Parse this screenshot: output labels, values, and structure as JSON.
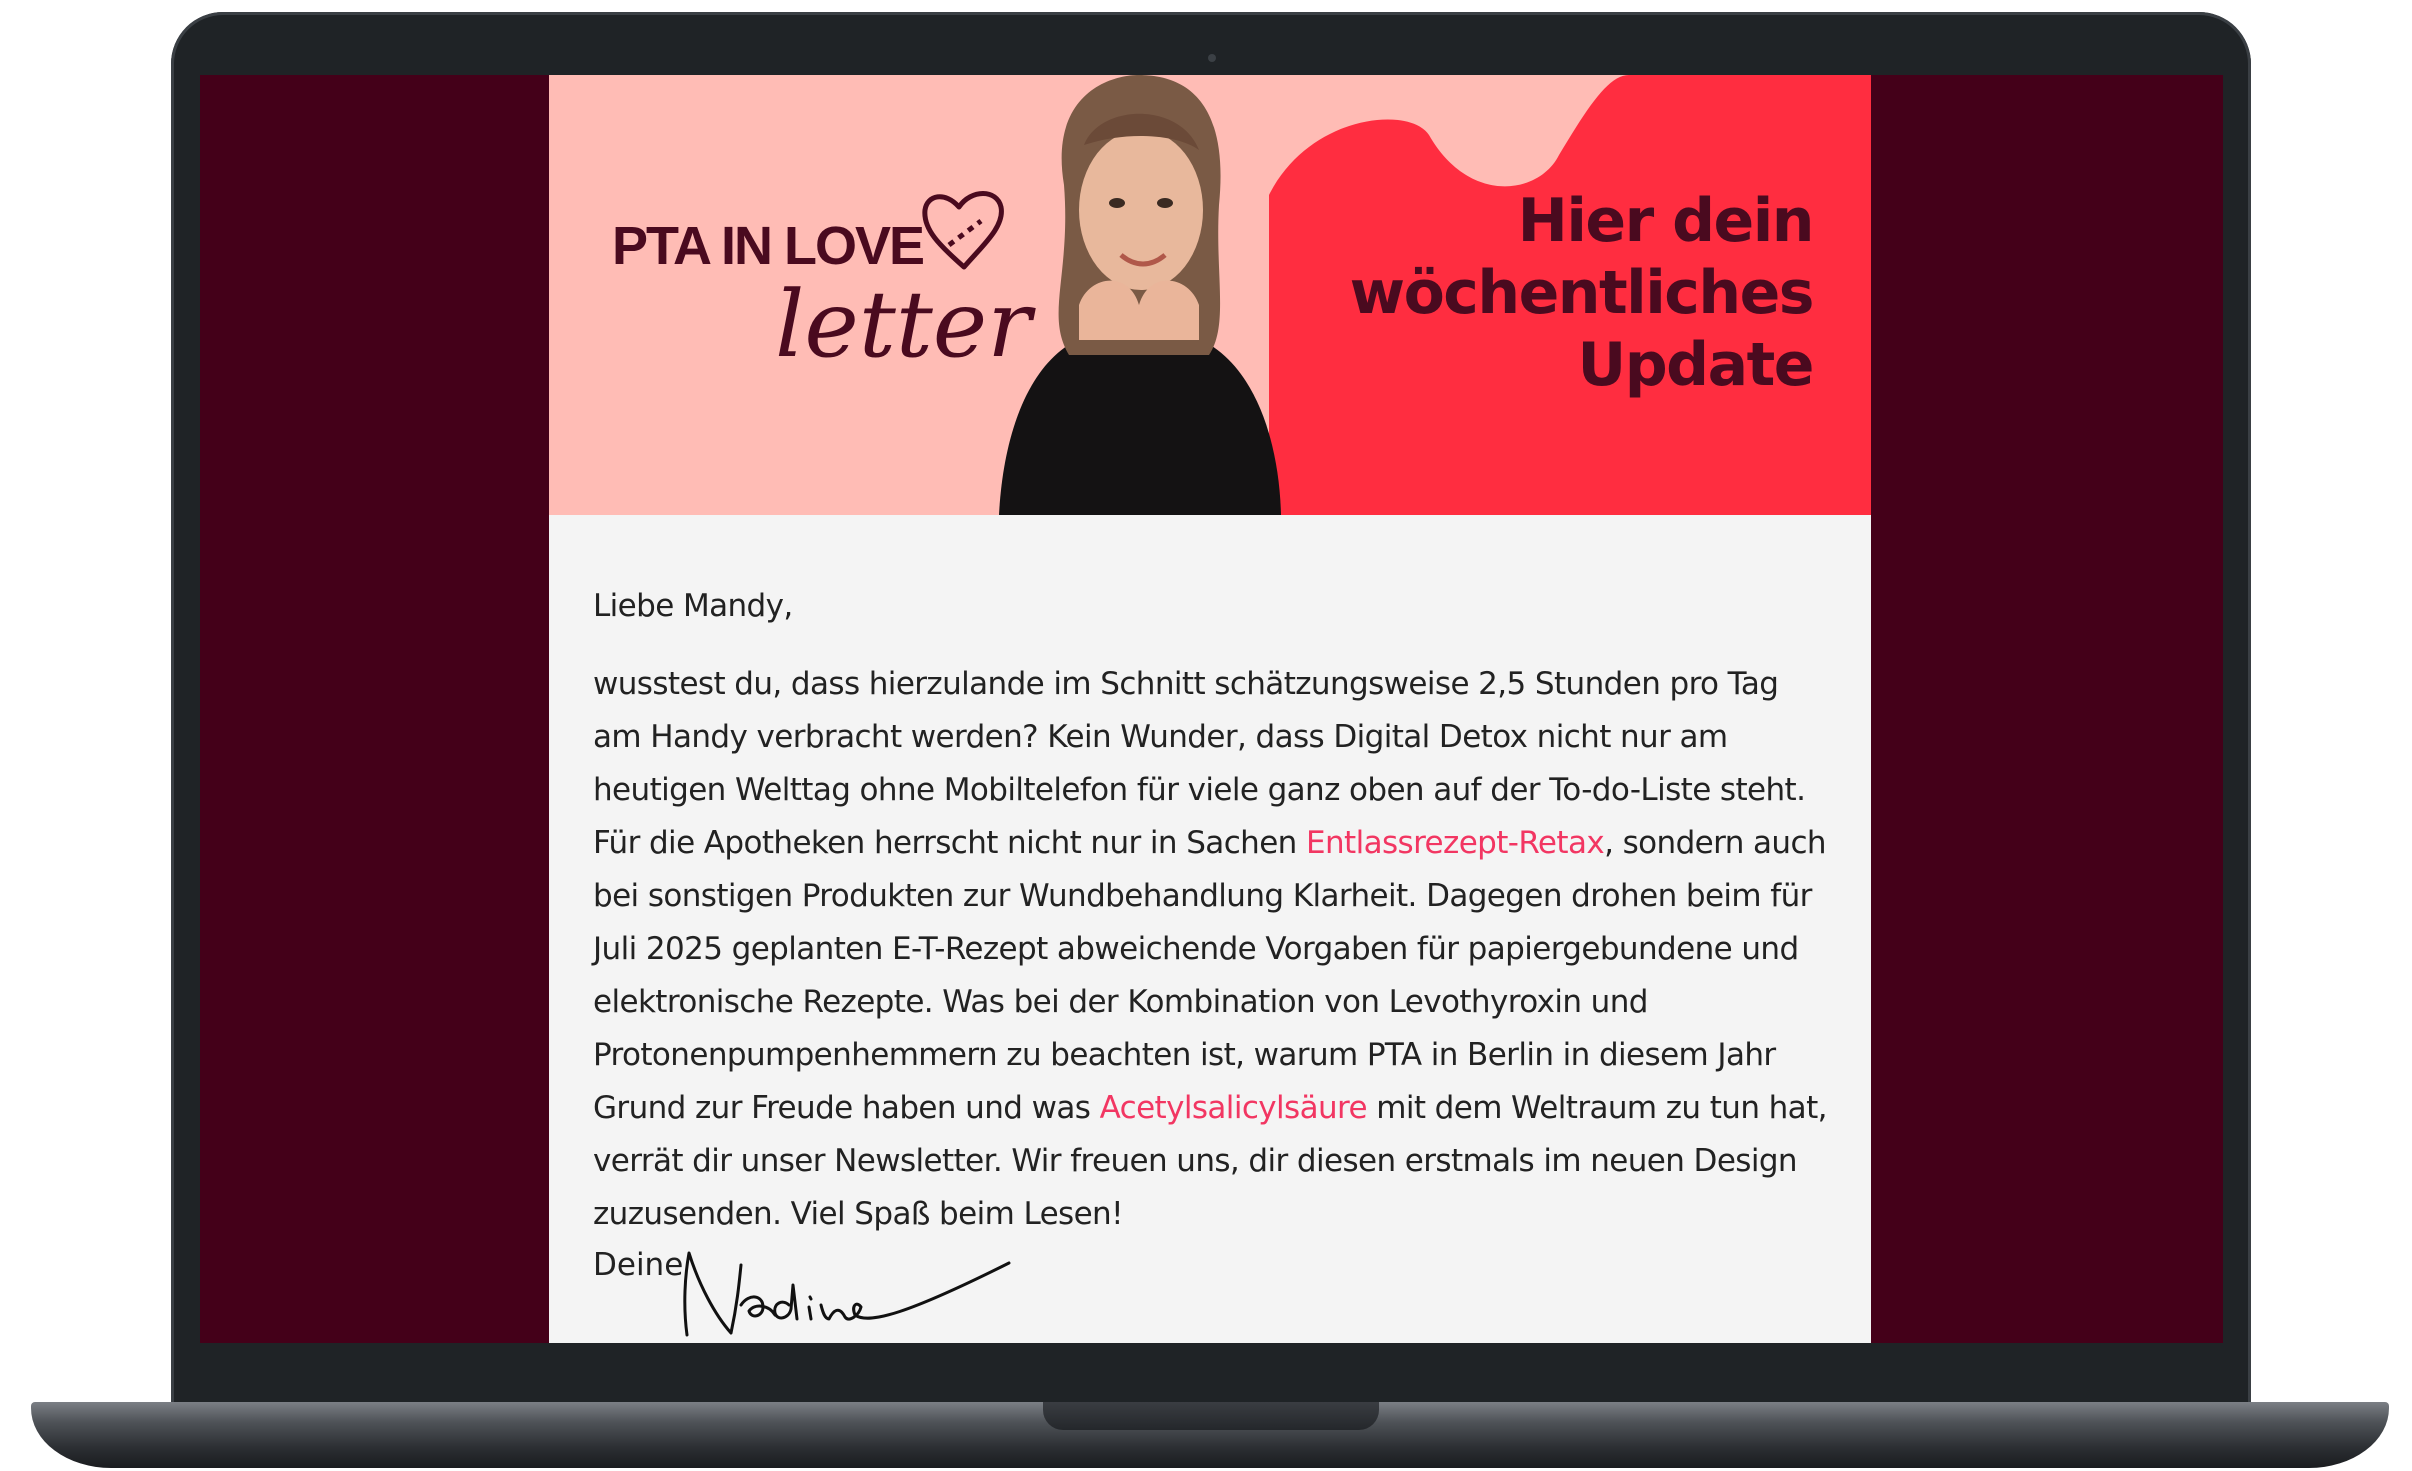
{
  "header": {
    "logo_line1": "PTA IN LOVE",
    "logo_line2": "letter",
    "headline_line1": "Hier dein",
    "headline_line2": "wöchentliches",
    "headline_line3": "Update"
  },
  "body": {
    "greeting": "Liebe Mandy,",
    "p1_part1": "wusstest du, dass hierzulande im Schnitt schätzungsweise 2,5 Stunden pro Tag am Handy verbracht werden? Kein Wunder, dass Digital Detox nicht nur am heutigen Welttag ohne Mobiltelefon für viele ganz oben auf der To-do-Liste steht. Für die Apotheken herrscht nicht nur in Sachen ",
    "link1": "Entlassrezept-Retax",
    "p1_part2": ", sondern auch bei sonstigen Produkten zur Wundbehandlung Klarheit. Dagegen drohen beim für Juli 2025 geplanten E-T-Rezept abweichende Vorgaben für papiergebundene und elektronische Rezepte. Was bei der Kombination von Levothyroxin und Protonenpumpenhemmern zu beachten ist, warum PTA in Berlin in diesem Jahr Grund zur Freude haben und was ",
    "link2": "Acetylsalicylsäure",
    "p1_part3": " mit dem Weltraum zu tun hat, verrät dir unser Newsletter. Wir freuen uns, dir diesen erstmals im neuen Design zuzusenden. Viel Spaß beim Lesen!",
    "signoff": "Deine",
    "signature": "Nadine"
  },
  "colors": {
    "screen_bg": "#440019",
    "header_pink": "#ffbcb5",
    "header_red": "#ff2d40",
    "brand_dark": "#4a0a1f",
    "link": "#f23662",
    "content_bg": "#f4f4f4"
  }
}
